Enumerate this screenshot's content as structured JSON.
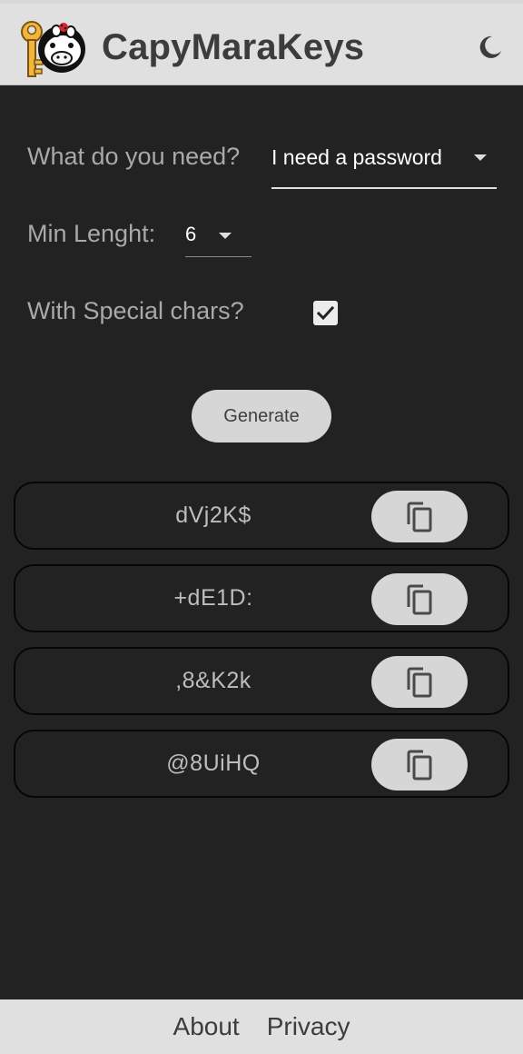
{
  "header": {
    "title": "CapyMaraKeys",
    "logo_icon": "capybara-key-logo-icon",
    "theme_icon": "moon-icon"
  },
  "form": {
    "need_label": "What do you need?",
    "need_value": "I need a password",
    "length_label": "Min Lenght:",
    "length_value": "6",
    "special_label": "With Special chars?",
    "special_checked": true
  },
  "generate_label": "Generate",
  "results": [
    {
      "text": "dVj2K$"
    },
    {
      "text": "+dE1D:"
    },
    {
      "text": ",8&K2k"
    },
    {
      "text": "@8UiHQ"
    }
  ],
  "copy_icon": "copy-icon",
  "footer": {
    "about": "About",
    "privacy": "Privacy"
  },
  "colors": {
    "background": "#222222",
    "bar": "#e0e0e0",
    "button": "#d6d6d6"
  }
}
